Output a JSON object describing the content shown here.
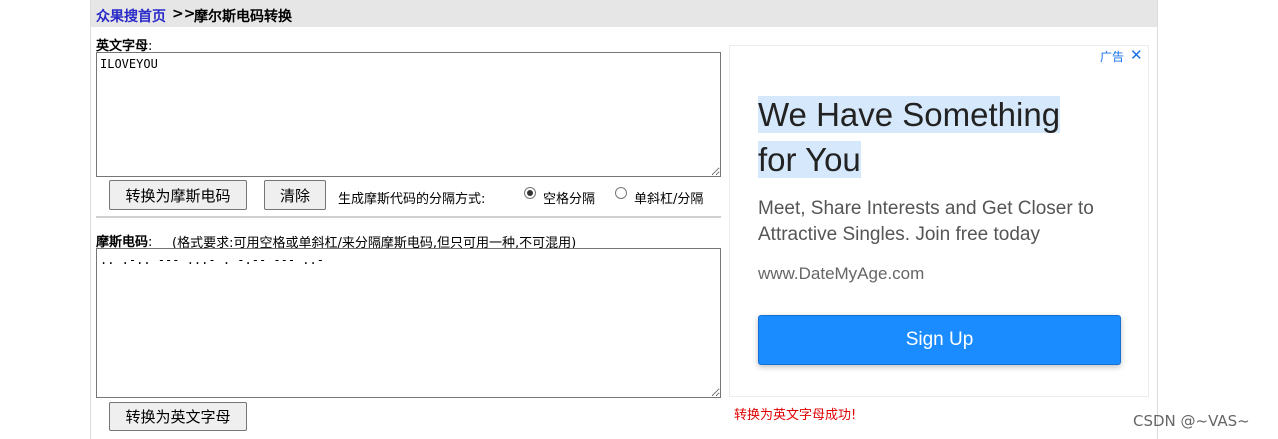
{
  "breadcrumb": {
    "home": "众果搜首页",
    "separator": ">>",
    "current": "摩尔斯电码转换"
  },
  "english_section": {
    "label": "英文字母",
    "colon": ":",
    "text_value": "ILOVEYOU",
    "to_morse_button": "转换为摩斯电码",
    "clear_button": "清除",
    "separator_mode_label": "生成摩斯代码的分隔方式:",
    "option_space": "空格分隔",
    "option_slash": "单斜杠/分隔",
    "selected_option": "空格分隔"
  },
  "morse_section": {
    "label": "摩斯电码",
    "colon": ":",
    "format_hint": "(格式要求:可用空格或单斜杠/来分隔摩斯电码,但只可用一种,不可混用)",
    "text_value": ".. .-.. --- ...- . -.-- --- ..-",
    "to_english_button": "转换为英文字母"
  },
  "status_message": "转换为英文字母成功!",
  "ad": {
    "badge": "广告",
    "close_icon": "close-icon",
    "headline_line1": "We Have Something",
    "headline_line2": "for You",
    "body": "Meet, Share Interests and Get Closer to Attractive Singles. Join free today",
    "url": "www.DateMyAge.com",
    "cta": "Sign Up",
    "cta_color": "#1a8cff"
  },
  "watermark": "CSDN @~VAS~"
}
